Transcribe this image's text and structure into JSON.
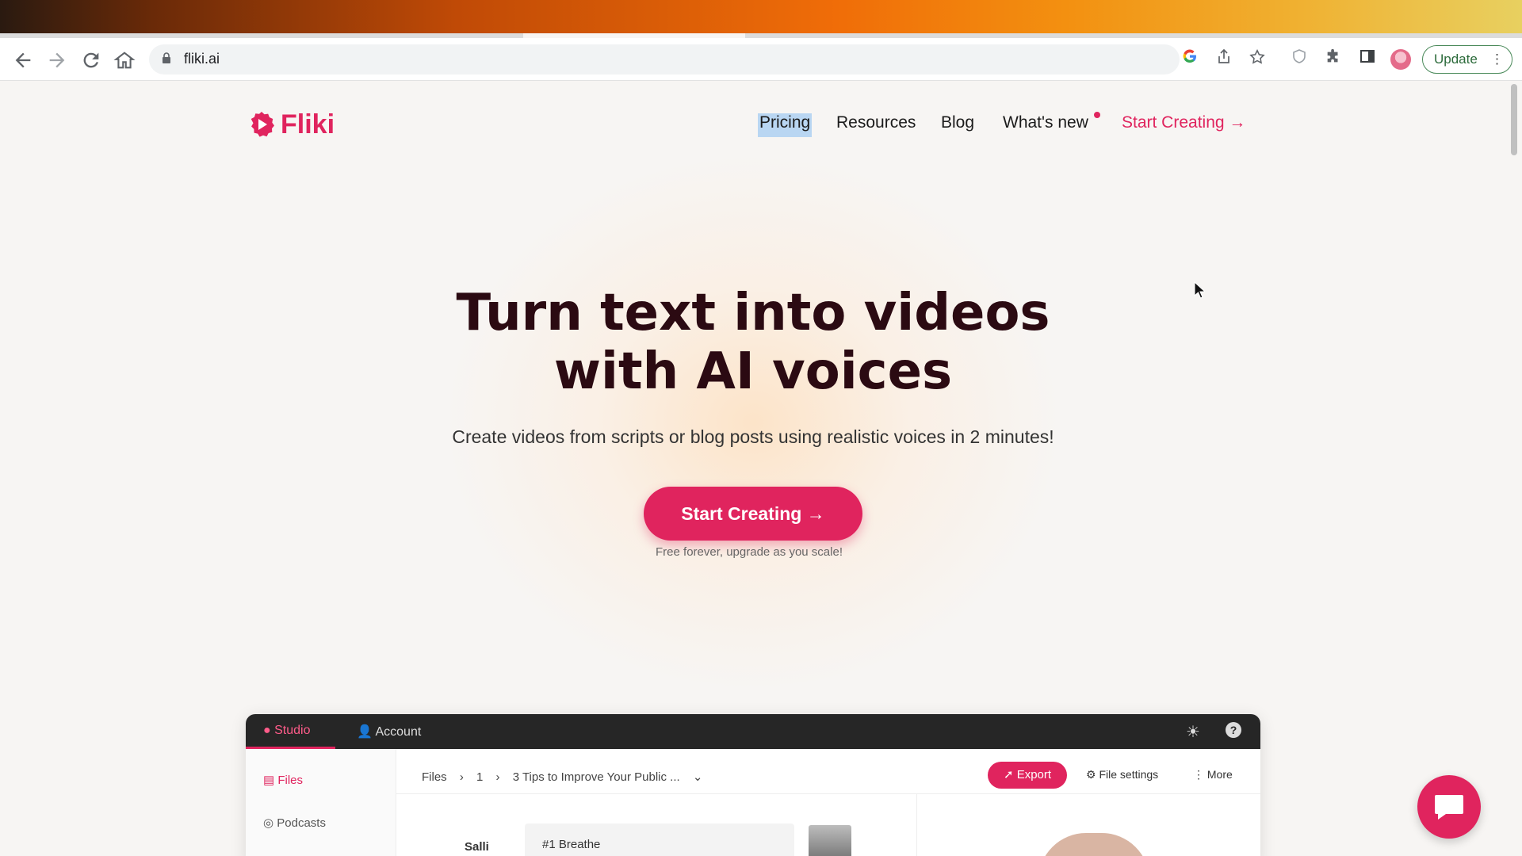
{
  "browser": {
    "url": "fliki.ai",
    "update_label": "Update",
    "update_menu": "⋮"
  },
  "site": {
    "logo_text": "Fliki",
    "nav": {
      "pricing": "Pricing",
      "resources": "Resources",
      "blog": "Blog",
      "whats_new": "What's new",
      "start_creating": "Start Creating →"
    }
  },
  "hero": {
    "title_line1": "Turn text into videos",
    "title_line2": "with AI voices",
    "subtitle": "Create videos from scripts or blog posts using realistic voices in 2 minutes!",
    "cta_label": "Start Creating →",
    "cta_note": "Free forever, upgrade as you scale!"
  },
  "preview": {
    "tabs": {
      "studio": "Studio",
      "account": "Account"
    },
    "sidebar": {
      "files": "Files",
      "podcasts": "Podcasts"
    },
    "breadcrumb": {
      "root": "Files",
      "sep1": "›",
      "folder": "1",
      "sep2": "›",
      "file": "3 Tips to Improve Your Public ...",
      "chevron": "⌄"
    },
    "actions": {
      "export": "Export",
      "file_settings": "File settings",
      "more": "More"
    },
    "voice": "Salli",
    "scene": "#1 Breathe"
  },
  "colors": {
    "brand": "#e0245e",
    "hero_text": "#2b0a12"
  },
  "icons": {
    "back": "back-arrow-icon",
    "forward": "forward-arrow-icon",
    "reload": "reload-icon",
    "home": "home-icon",
    "lock": "lock-icon",
    "google": "google-icon",
    "share": "share-icon",
    "star": "star-icon",
    "shield": "shield-icon",
    "extensions": "puzzle-icon",
    "sidepanel": "side-panel-icon",
    "chat": "chat-bubble-icon"
  }
}
